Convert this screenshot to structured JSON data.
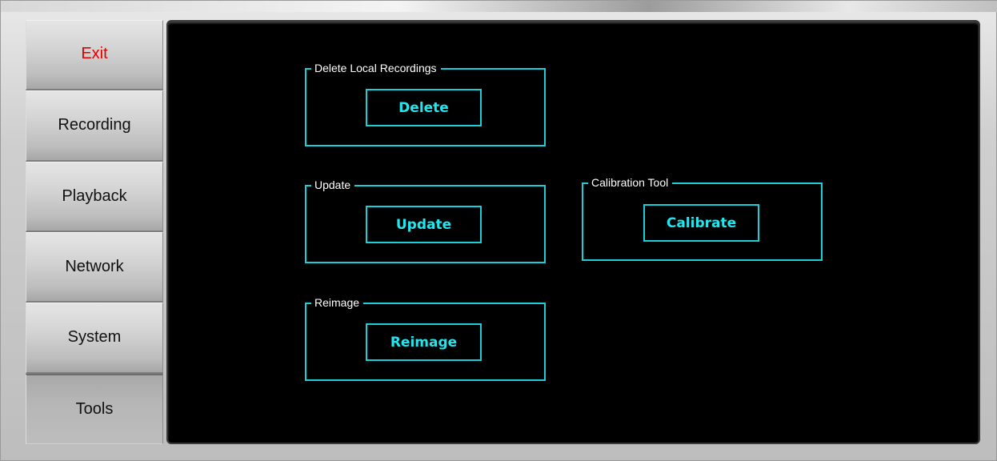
{
  "sidebar": {
    "items": [
      {
        "label": "Exit"
      },
      {
        "label": "Recording"
      },
      {
        "label": "Playback"
      },
      {
        "label": "Network"
      },
      {
        "label": "System"
      },
      {
        "label": "Tools"
      }
    ],
    "active": "Tools"
  },
  "tools": {
    "delete_group": {
      "legend": "Delete Local Recordings",
      "button": "Delete"
    },
    "update_group": {
      "legend": "Update",
      "button": "Update"
    },
    "calibration_group": {
      "legend": "Calibration Tool",
      "button": "Calibrate"
    },
    "reimage_group": {
      "legend": "Reimage",
      "button": "Reimage"
    }
  },
  "colors": {
    "accent": "#1ad0d8",
    "exit_text": "#e00000",
    "panel_background": "#000000"
  }
}
